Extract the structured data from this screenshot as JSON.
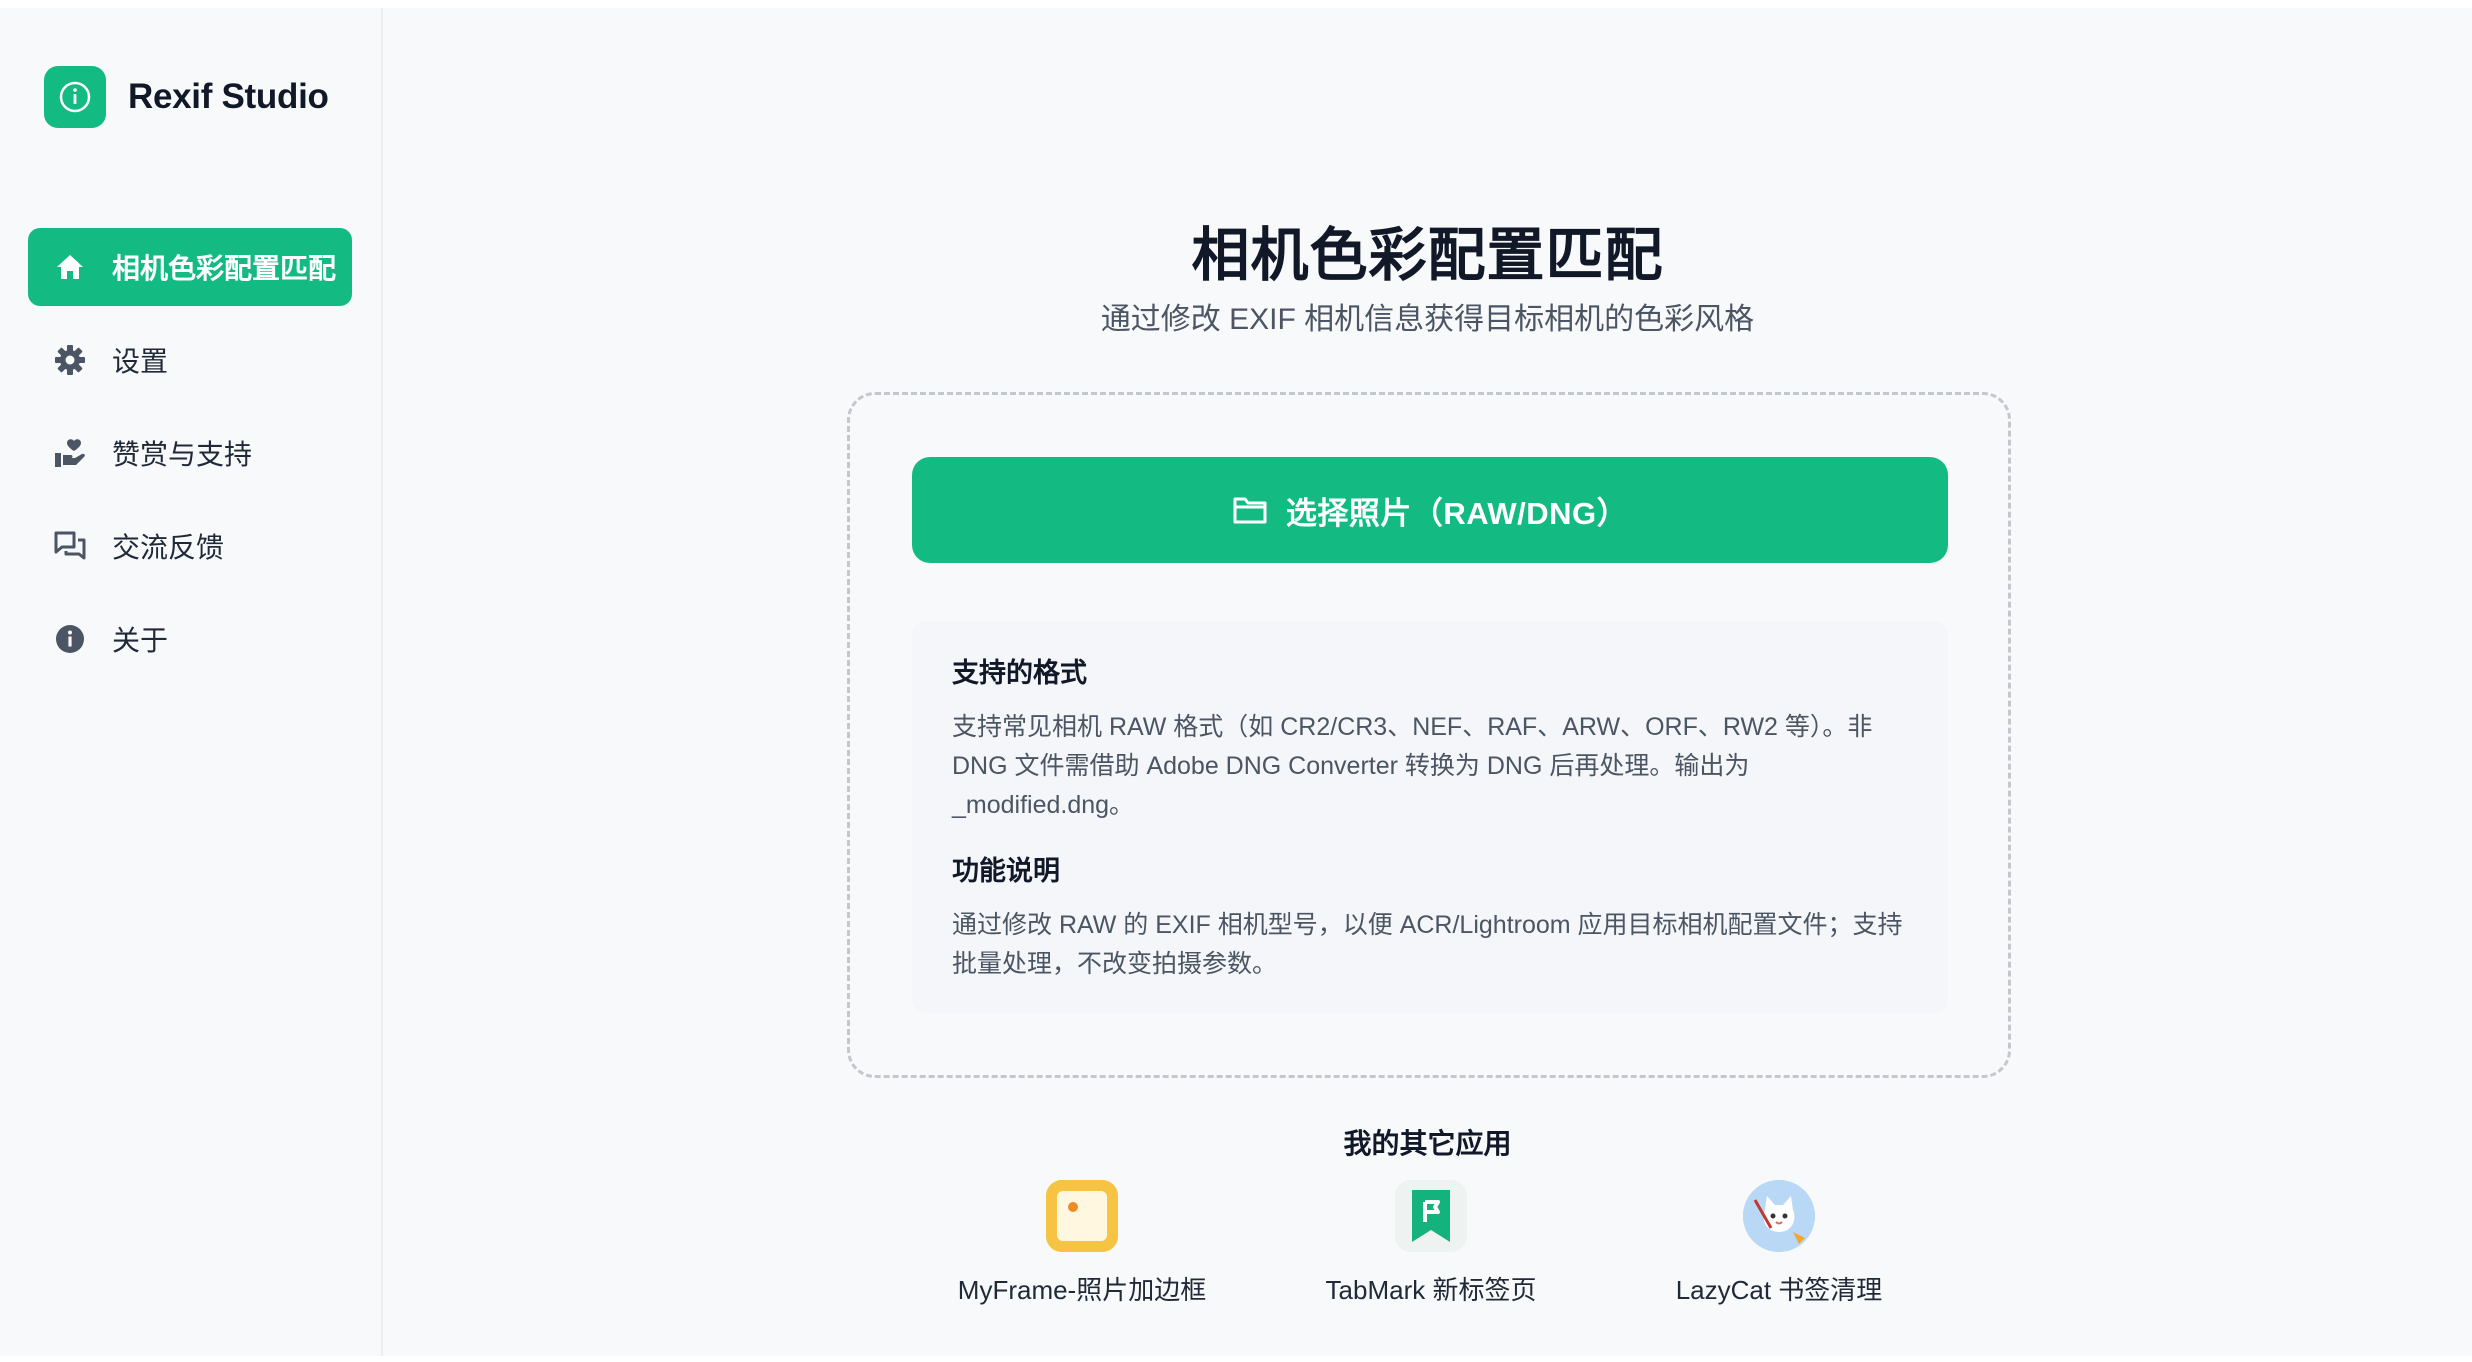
{
  "app": {
    "name": "Rexif Studio",
    "logo_icon": "info-circle-icon",
    "accent": "#13bb82"
  },
  "sidebar": {
    "items": [
      {
        "label": "相机色彩配置匹配",
        "icon": "home-icon",
        "active": true
      },
      {
        "label": "设置",
        "icon": "gear-icon",
        "active": false
      },
      {
        "label": "赞赏与支持",
        "icon": "hand-heart-icon",
        "active": false
      },
      {
        "label": "交流反馈",
        "icon": "chat-bubbles-icon",
        "active": false
      },
      {
        "label": "关于",
        "icon": "info-icon",
        "active": false
      }
    ]
  },
  "main": {
    "title": "相机色彩配置匹配",
    "subtitle": "通过修改 EXIF 相机信息获得目标相机的色彩风格",
    "select_button": {
      "label": "选择照片（RAW/DNG）",
      "icon": "folder-icon"
    },
    "info": {
      "formats_heading": "支持的格式",
      "formats_text": "支持常见相机 RAW 格式（如 CR2/CR3、NEF、RAF、ARW、ORF、RW2 等）。非 DNG 文件需借助 Adobe DNG Converter 转换为 DNG 后再处理。输出为 _modified.dng。",
      "features_heading": "功能说明",
      "features_text": "通过修改 RAW 的 EXIF 相机型号，以便 ACR/Lightroom 应用目标相机配置文件；支持批量处理，不改变拍摄参数。"
    },
    "other_apps": {
      "title": "我的其它应用",
      "apps": [
        {
          "label": "MyFrame-照片加边框",
          "icon": "photo-frame-icon"
        },
        {
          "label": "TabMark 新标签页",
          "icon": "bookmark-icon"
        },
        {
          "label": "LazyCat 书签清理",
          "icon": "cat-icon"
        }
      ]
    }
  }
}
